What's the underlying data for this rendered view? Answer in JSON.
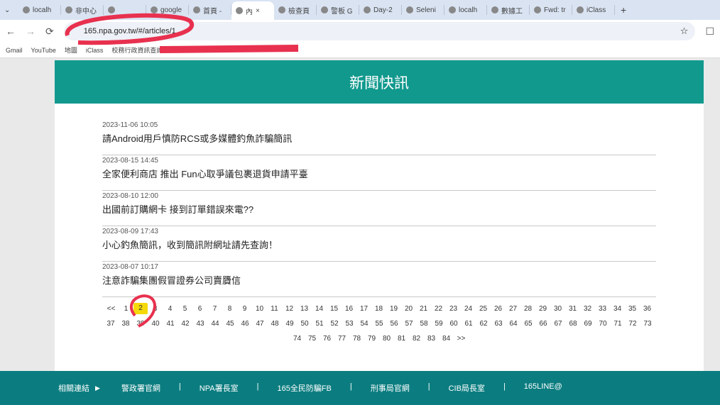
{
  "browser": {
    "tabs": [
      "localh",
      "非中心",
      "",
      "google",
      "首頁 -",
      "內",
      "檢查頁",
      "警板 G",
      "Day-2",
      "Seleni",
      "localh",
      "數據工",
      "Fwd: tr",
      "iClass"
    ],
    "active_tab": 5,
    "url": "165.npa.gov.tw/#/articles/1",
    "bookmarks": [
      "Gmail",
      "YouTube",
      "地圖",
      "iClass",
      "校務行政資訊查詢..."
    ]
  },
  "header": {
    "title": "新聞快訊"
  },
  "articles": [
    {
      "date": "2023-11-06 10:05",
      "title": "請Android用戶慎防RCS或多媒體釣魚詐騙簡訊"
    },
    {
      "date": "2023-08-15 14:45",
      "title": "全家便利商店 推出 Fun心取爭議包裹退貨申請平臺"
    },
    {
      "date": "2023-08-10 12:00",
      "title": "出國前訂購網卡 接到訂單錯誤來電??"
    },
    {
      "date": "2023-08-09 17:43",
      "title": "小心釣魚簡訊，收到簡訊附網址請先查詢！"
    },
    {
      "date": "2023-08-07 10:17",
      "title": "注意詐騙集團假冒證券公司賣贗信"
    }
  ],
  "pagination": {
    "prev": "<<",
    "next": ">>",
    "first": 1,
    "last": 84,
    "current": 2,
    "highlight_color": "#f5d90a"
  },
  "footer": {
    "label": "相關連結",
    "links": [
      "警政署官網",
      "NPA署長室",
      "165全民防騙FB",
      "刑事局官網",
      "CIB局長室",
      "165LINE@"
    ]
  },
  "colors": {
    "header": "#12998e",
    "footer": "#0b7d80",
    "annotation": "#e8314f"
  }
}
